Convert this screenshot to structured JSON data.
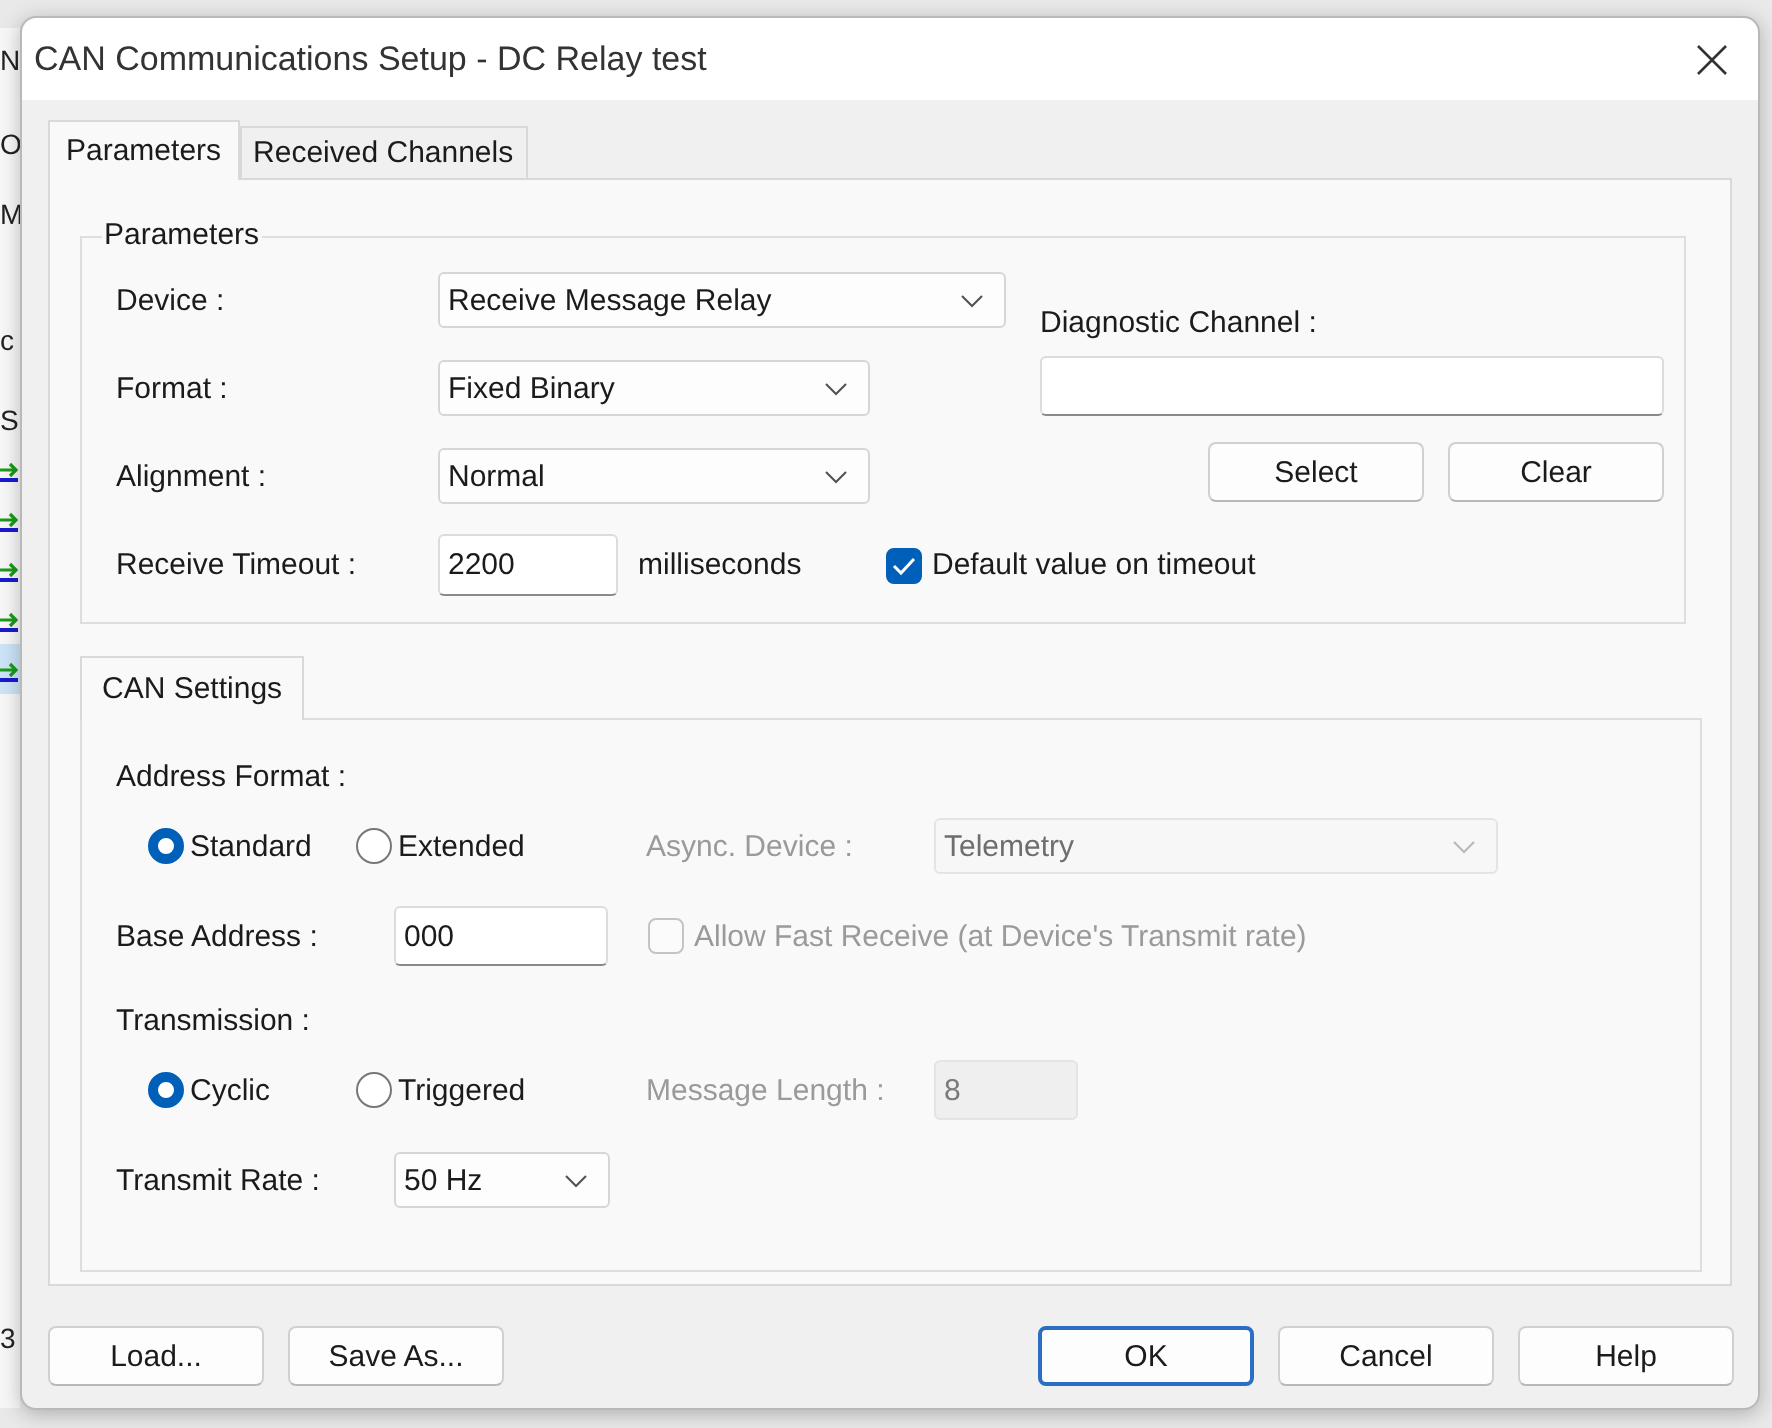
{
  "background_window": {
    "fragments": [
      "N",
      "O",
      "M",
      "c",
      "S"
    ],
    "rows": [
      {
        "selected": false
      },
      {
        "selected": false
      },
      {
        "selected": false
      },
      {
        "selected": false
      },
      {
        "selected": true
      }
    ],
    "footer_fragment": "3"
  },
  "dialog": {
    "title": "CAN Communications Setup - DC Relay test",
    "tabs": [
      {
        "label": "Parameters",
        "selected": true
      },
      {
        "label": "Received Channels",
        "selected": false
      }
    ],
    "parameters": {
      "legend": "Parameters",
      "device": {
        "label": "Device :",
        "value": "Receive Message Relay"
      },
      "format": {
        "label": "Format :",
        "value": "Fixed Binary"
      },
      "alignment": {
        "label": "Alignment :",
        "value": "Normal"
      },
      "diagnostic_channel": {
        "label": "Diagnostic Channel :"
      },
      "buttons": [
        "Select",
        "Clear"
      ],
      "receive_timeout": {
        "label": "Receive Timeout :",
        "value": "2200",
        "unit": "milliseconds"
      },
      "default_on_timeout": {
        "label": "Default value on timeout",
        "checked": true
      }
    },
    "can_tabs": [
      {
        "label": "CAN Settings",
        "selected": true
      }
    ],
    "can_settings": {
      "address_format": {
        "label": "Address Format :",
        "options": [
          {
            "label": "Standard",
            "selected": true
          },
          {
            "label": "Extended",
            "selected": false
          }
        ]
      },
      "async_device": {
        "label": "Async. Device :",
        "value": "Telemetry",
        "disabled": true
      },
      "base_address": {
        "label": "Base Address :",
        "value": "000"
      },
      "allow_fast_receive": {
        "label": "Allow Fast Receive (at Device's Transmit rate)",
        "checked": false,
        "disabled": true
      },
      "transmission": {
        "label": "Transmission :",
        "options": [
          {
            "label": "Cyclic",
            "selected": true
          },
          {
            "label": "Triggered",
            "selected": false
          }
        ]
      },
      "message_length": {
        "label": "Message Length :",
        "value": "8",
        "disabled": true
      },
      "transmit_rate": {
        "label": "Transmit Rate :",
        "value": "50 Hz"
      }
    },
    "buttons": [
      {
        "label": "Load...",
        "default": false
      },
      {
        "label": "Save As...",
        "default": false
      },
      {
        "label": "OK",
        "default": true
      },
      {
        "label": "Cancel",
        "default": false
      },
      {
        "label": "Help",
        "default": false
      }
    ]
  }
}
